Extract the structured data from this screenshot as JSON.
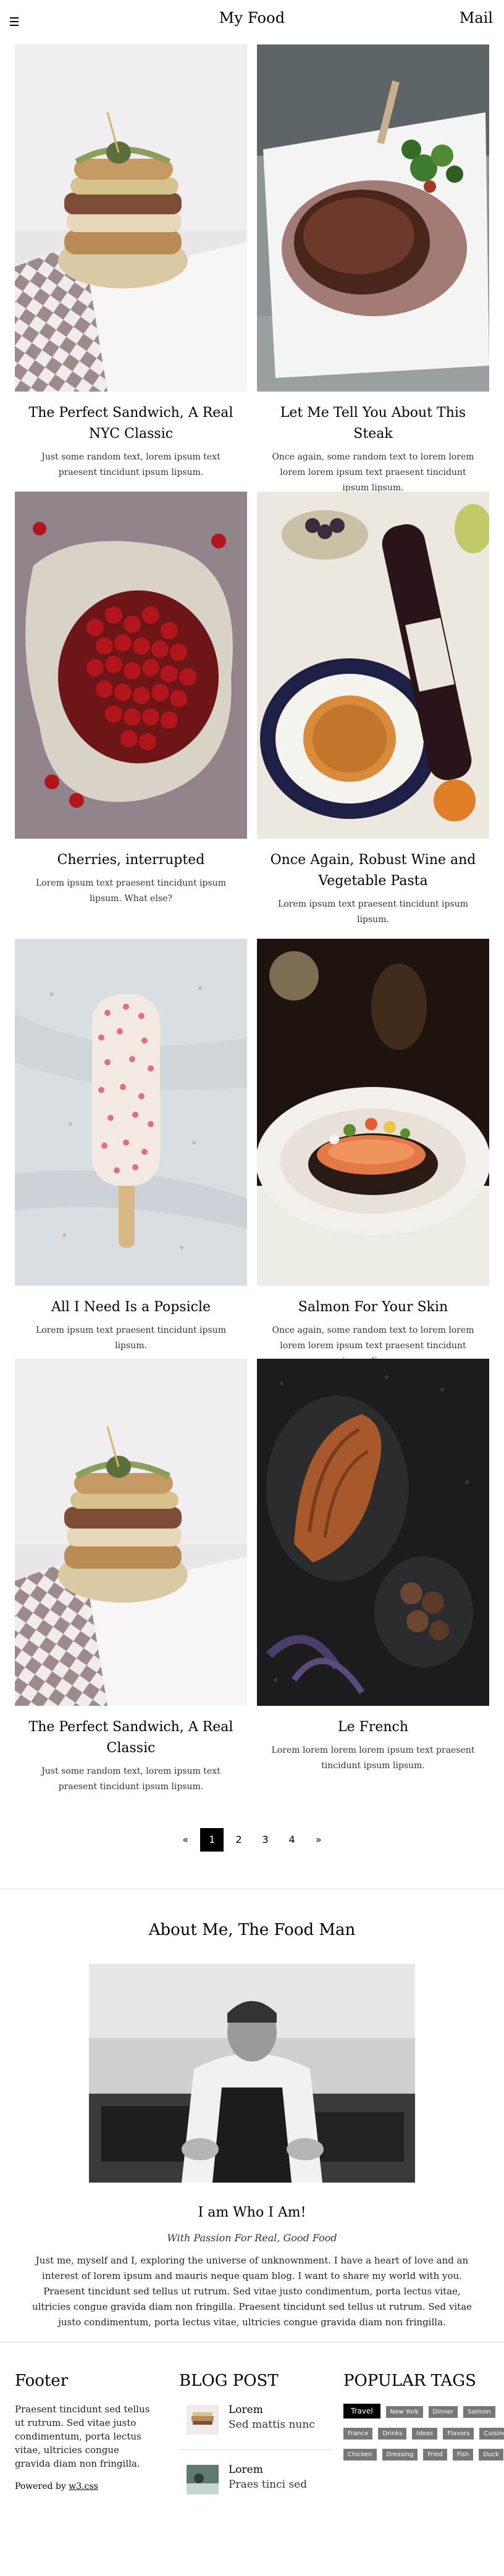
{
  "header": {
    "title": "My Food",
    "mail_label": "Mail",
    "menu_icon": "hamburger-icon"
  },
  "posts": [
    {
      "title": "The Perfect Sandwich, A Real NYC Classic",
      "text": "Just some random text, lorem ipsum text praesent tincidunt ipsum lipsum."
    },
    {
      "title": "Let Me Tell You About This Steak",
      "text": "Once again, some random text to lorem lorem lorem lorem ipsum text praesent tincidunt ipsum lipsum."
    },
    {
      "title": "Cherries, interrupted",
      "text": "Lorem ipsum text praesent tincidunt ipsum lipsum. What else?"
    },
    {
      "title": "Once Again, Robust Wine and Vegetable Pasta",
      "text": "Lorem ipsum text praesent tincidunt ipsum lipsum."
    },
    {
      "title": "All I Need Is a Popsicle",
      "text": "Lorem ipsum text praesent tincidunt ipsum lipsum."
    },
    {
      "title": "Salmon For Your Skin",
      "text": "Once again, some random text to lorem lorem lorem lorem ipsum text praesent tincidunt ipsum lipsum."
    },
    {
      "title": "The Perfect Sandwich, A Real Classic",
      "text": "Just some random text, lorem ipsum text praesent tincidunt ipsum lipsum."
    },
    {
      "title": "Le French",
      "text": "Lorem lorem lorem lorem ipsum text praesent tincidunt ipsum lipsum."
    }
  ],
  "pagination": {
    "prev": "«",
    "pages": [
      "1",
      "2",
      "3",
      "4"
    ],
    "active": "1",
    "next": "»"
  },
  "about": {
    "title": "About Me, The Food Man",
    "name": "I am Who I Am!",
    "subtitle": "With Passion For Real, Good Food",
    "text": "Just me, myself and I, exploring the universe of unknownment. I have a heart of love and an interest of lorem ipsum and mauris neque quam blog. I want to share my world with you. Praesent tincidunt sed tellus ut rutrum. Sed vitae justo condimentum, porta lectus vitae, ultricies congue gravida diam non fringilla. Praesent tincidunt sed tellus ut rutrum. Sed vitae justo condimentum, porta lectus vitae, ultricies congue gravida diam non fringilla."
  },
  "footer": {
    "title": "Footer",
    "text": "Praesent tincidunt sed tellus ut rutrum. Sed vitae justo condimentum, porta lectus vitae, ultricies congue gravida diam non fringilla.",
    "powered_prefix": "Powered by ",
    "powered_link": "w3.css"
  },
  "blog_post": {
    "title": "BLOG POST",
    "items": [
      {
        "title": "Lorem",
        "subtitle": "Sed mattis nunc"
      },
      {
        "title": "Lorem",
        "subtitle": "Praes tinci sed"
      }
    ]
  },
  "popular_tags": {
    "title": "POPULAR TAGS",
    "tags": [
      "Travel",
      "New York",
      "Dinner",
      "Salmon",
      "France",
      "Drinks",
      "Ideas",
      "Flavors",
      "Cuisine",
      "Chicken",
      "Dressing",
      "Fried",
      "Fish",
      "Duck"
    ]
  }
}
